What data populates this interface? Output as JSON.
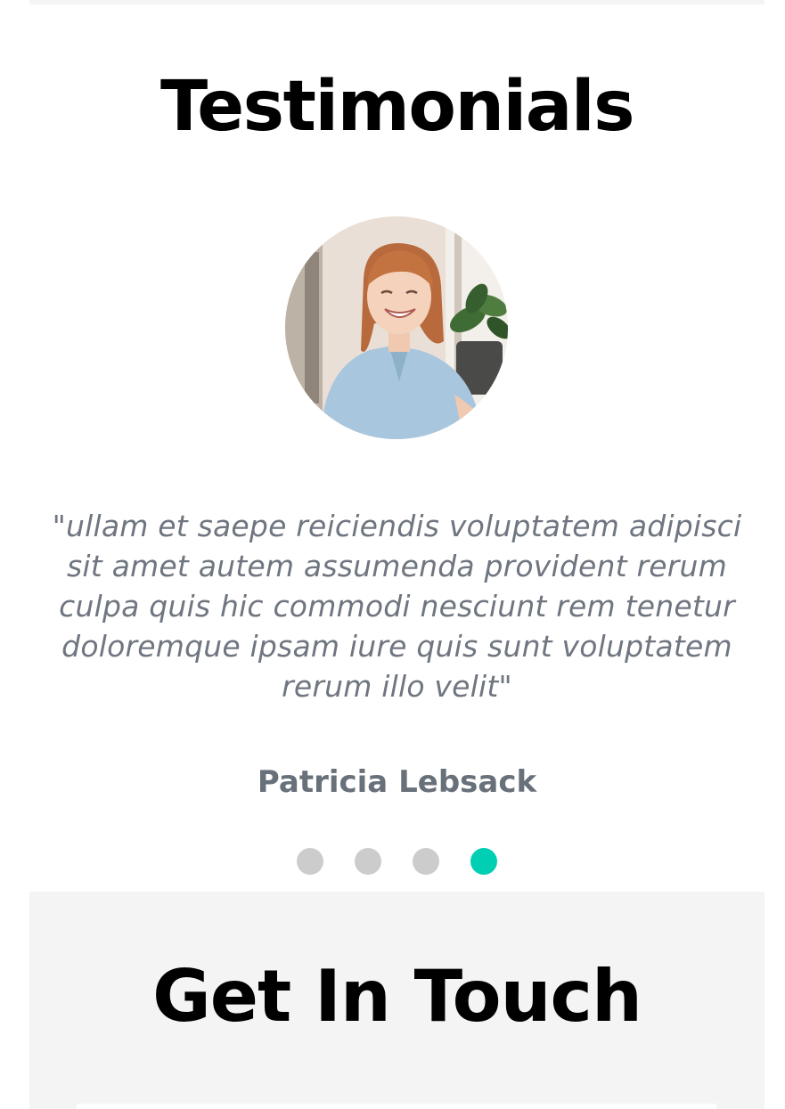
{
  "testimonials": {
    "title": "Testimonials",
    "quote": "\"ullam et saepe reiciendis voluptatem adipisci sit amet autem assumenda provident rerum culpa quis hic commodi nesciunt rem tenetur doloremque ipsam iure quis sunt voluptatem rerum illo velit\"",
    "author": "Patricia Lebsack",
    "slides_total": 4,
    "active_slide": 4
  },
  "contact": {
    "title": "Get In Touch"
  },
  "colors": {
    "accent": "#00cfb4",
    "dot_inactive": "#cccccc",
    "quote_text": "#6f7680",
    "section_bg": "#f4f4f4"
  }
}
